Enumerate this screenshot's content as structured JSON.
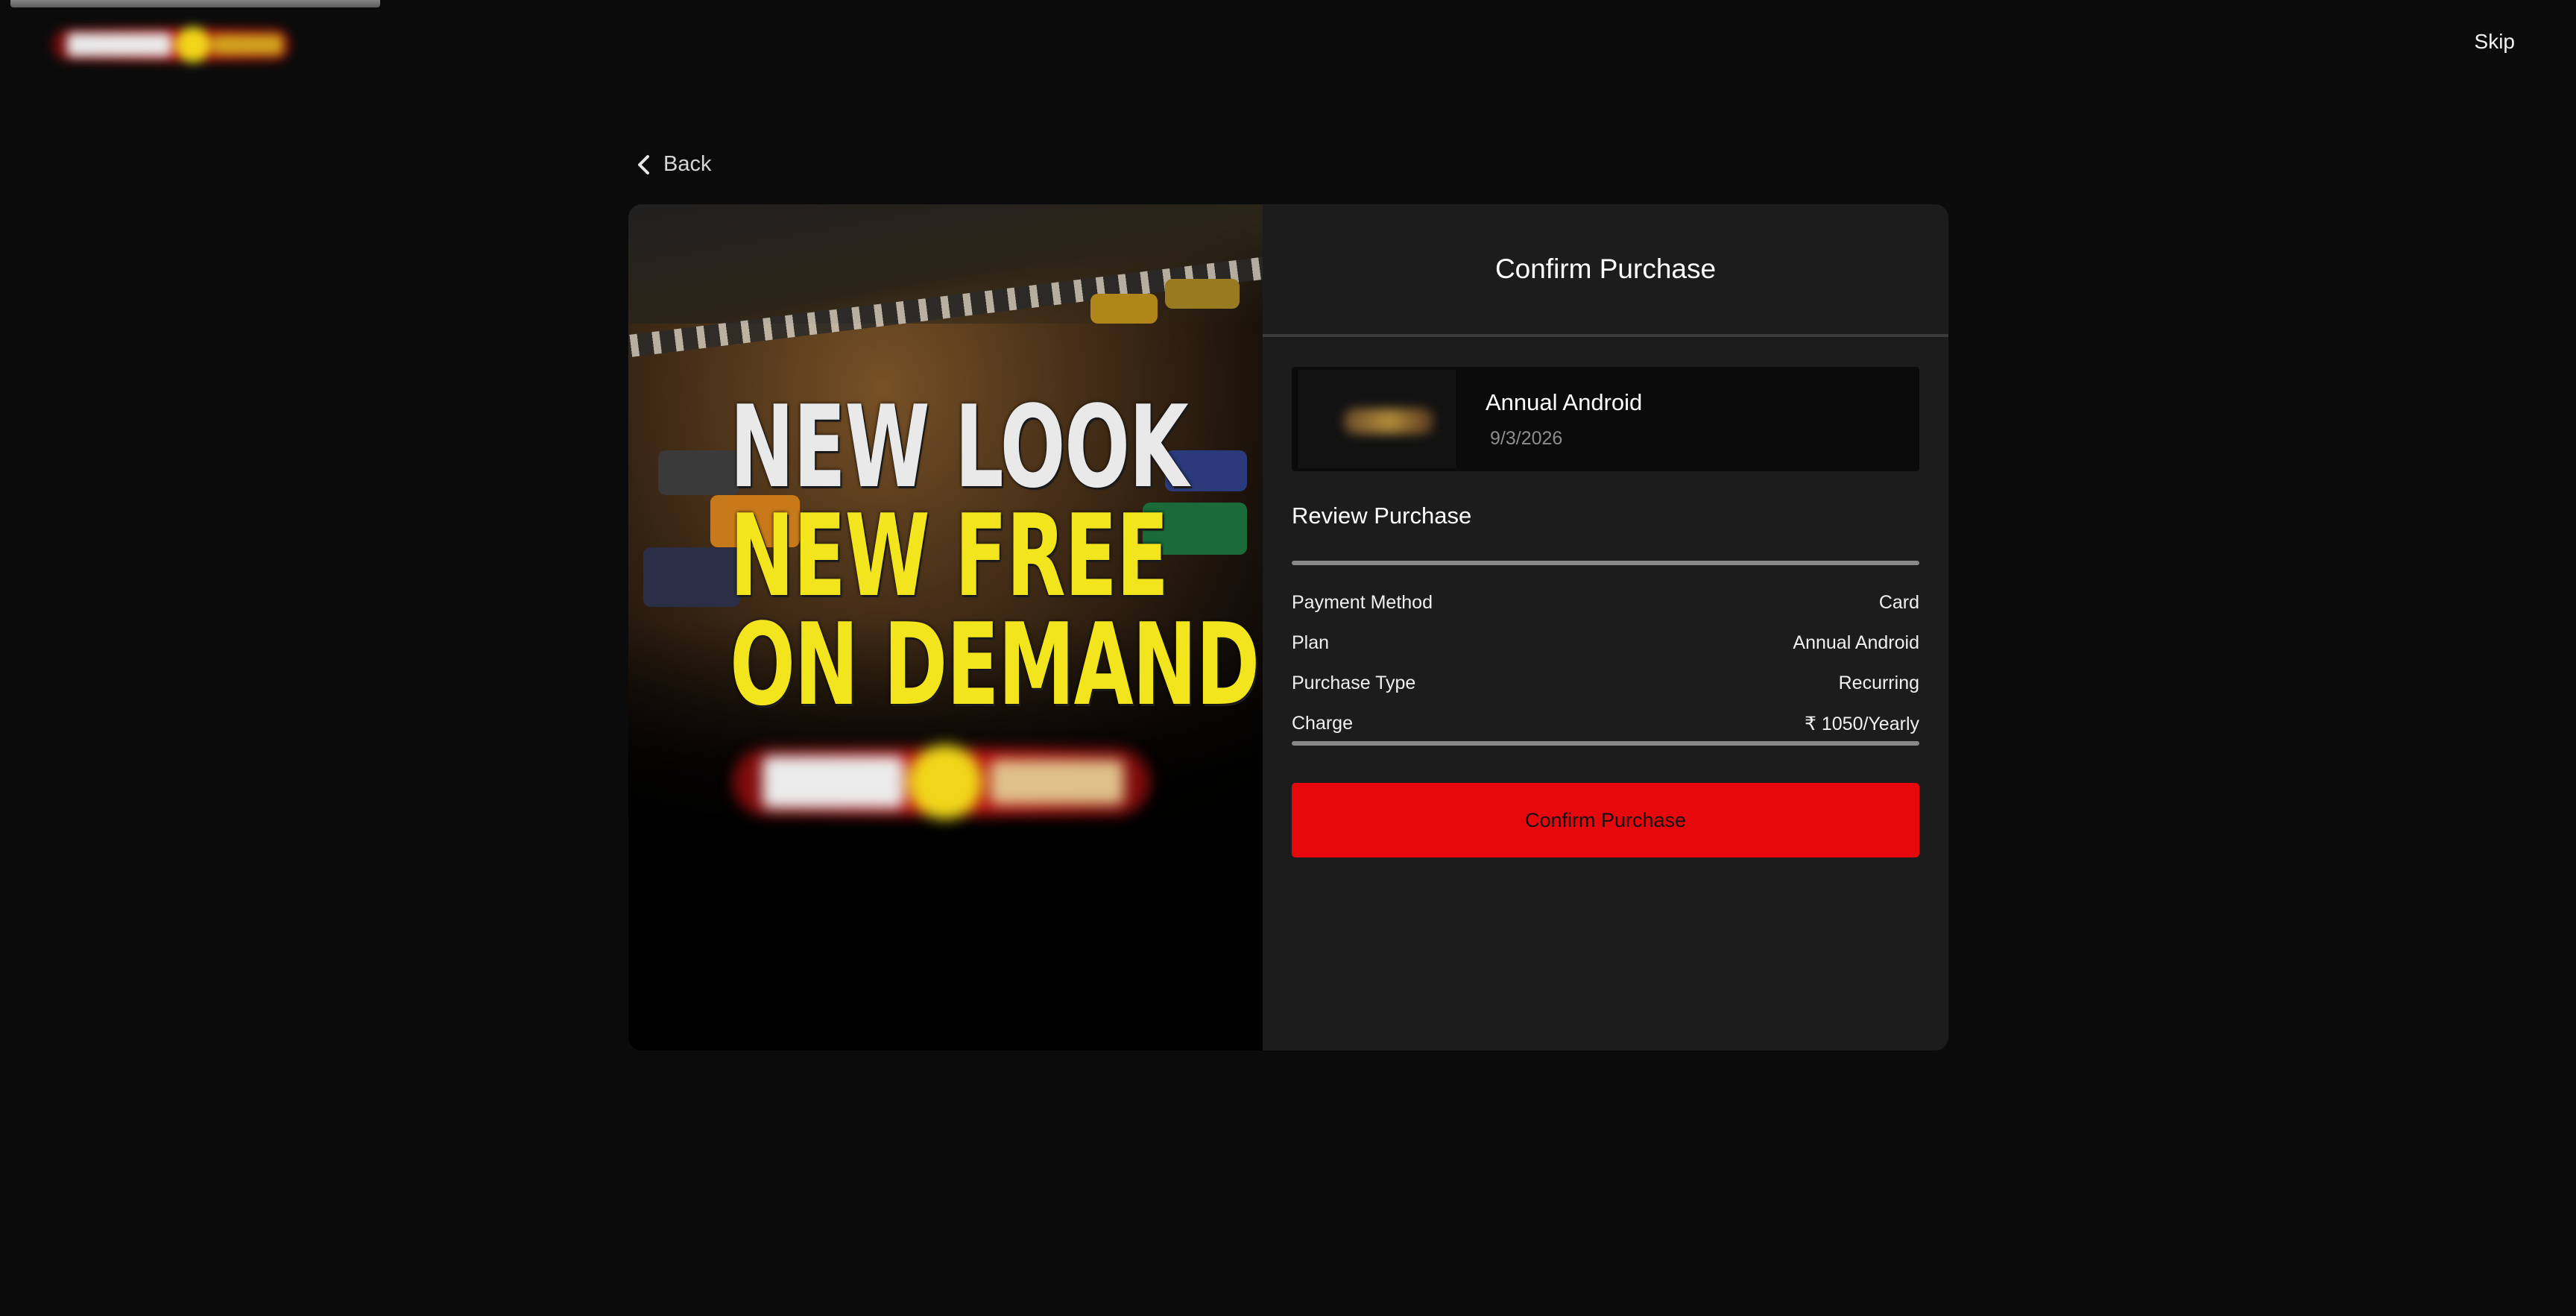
{
  "header": {
    "skip_label": "Skip"
  },
  "nav": {
    "back_label": "Back"
  },
  "promo": {
    "headline_line1": "NEW LOOK",
    "headline_line2": "NEW FREE",
    "headline_line3": "ON DEMAND"
  },
  "panel": {
    "title": "Confirm Purchase",
    "plan": {
      "name": "Annual Android",
      "date": "9/3/2026"
    },
    "review": {
      "title": "Review Purchase",
      "rows": [
        {
          "label": "Payment Method",
          "value": "Card"
        },
        {
          "label": "Plan",
          "value": "Annual Android"
        },
        {
          "label": "Purchase Type",
          "value": "Recurring"
        },
        {
          "label": "Charge",
          "value": "₹ 1050/Yearly"
        }
      ]
    },
    "confirm_label": "Confirm Purchase"
  },
  "colors": {
    "background": "#0b0b0b",
    "panel": "#1c1c1c",
    "accent": "#e7080e",
    "headline_white": "#e9e9e9",
    "headline_yellow": "#f2e51e"
  },
  "icons": {
    "back": "chevron-left-icon"
  }
}
